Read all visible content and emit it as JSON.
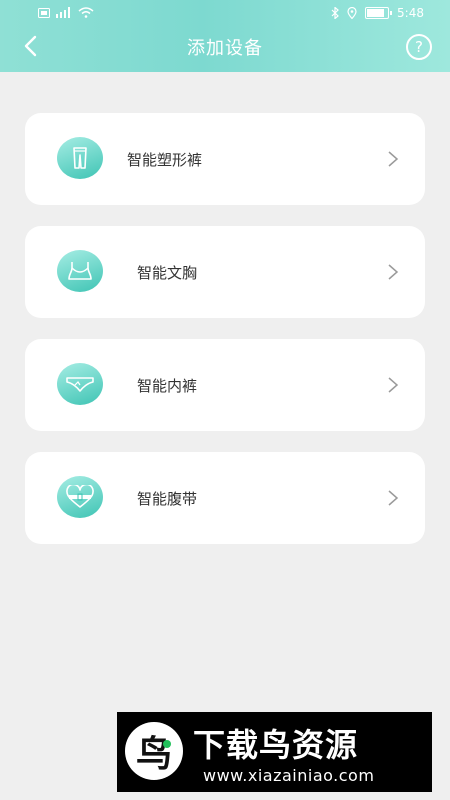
{
  "status_bar": {
    "left_icons": [
      "sim-card-icon",
      "signal-icon",
      "wifi-icon"
    ],
    "right_icons": [
      "bluetooth-icon",
      "location-icon",
      "battery-icon"
    ],
    "time": "5:48",
    "battery_level": 0.85
  },
  "header": {
    "title": "添加设备",
    "back_icon": "chevron-left-icon",
    "help_label": "?"
  },
  "devices": [
    {
      "label": "智能塑形裤",
      "icon": "shaping-pants-icon"
    },
    {
      "label": "智能文胸",
      "icon": "bra-icon"
    },
    {
      "label": "智能内裤",
      "icon": "underwear-icon"
    },
    {
      "label": "智能腹带",
      "icon": "belly-band-icon"
    }
  ],
  "watermark": {
    "logo_char": "鸟",
    "title": "下载鸟资源",
    "url": "www.xiazainiao.com"
  },
  "colors": {
    "header_start": "#8fe0d5",
    "header_end": "#9ee8dd",
    "accent": "#3fc4b4",
    "background": "#efefef"
  }
}
